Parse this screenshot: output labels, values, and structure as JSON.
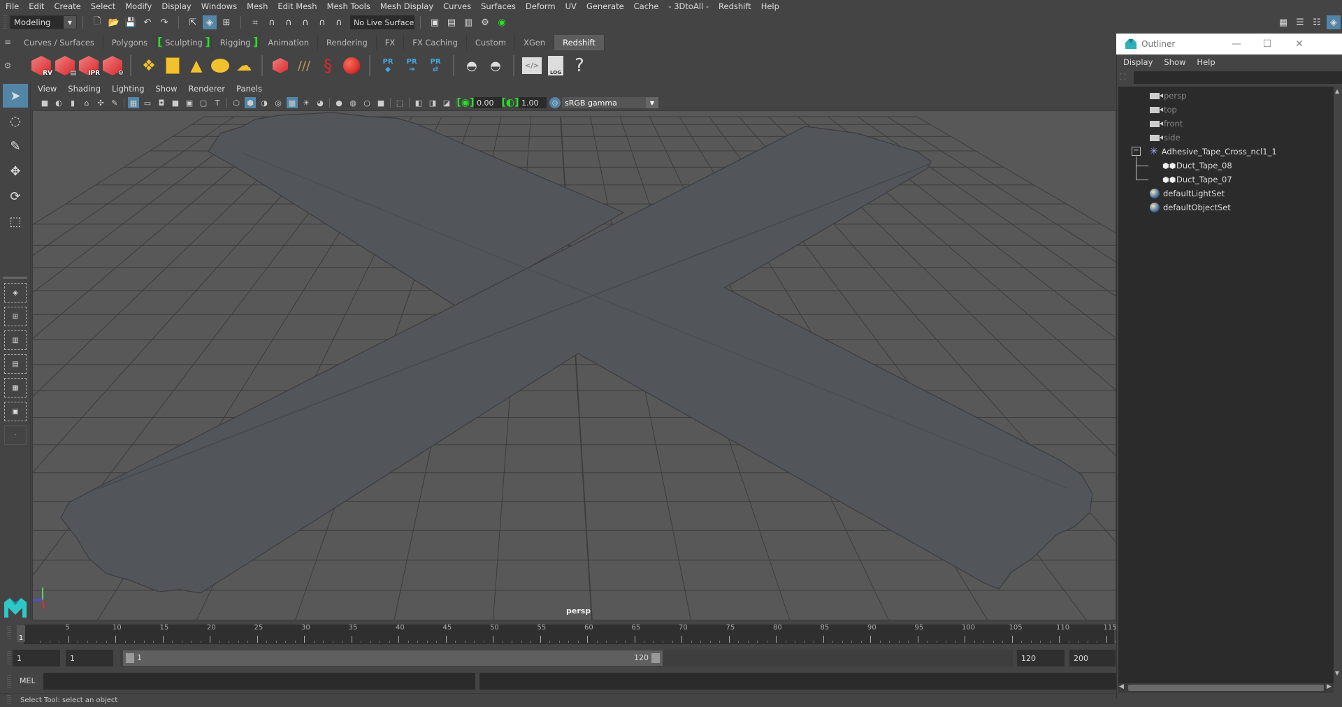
{
  "menubar": [
    "File",
    "Edit",
    "Create",
    "Select",
    "Modify",
    "Display",
    "Windows",
    "Mesh",
    "Edit Mesh",
    "Mesh Tools",
    "Mesh Display",
    "Curves",
    "Surfaces",
    "Deform",
    "UV",
    "Generate",
    "Cache",
    "- 3DtoAll -",
    "Redshift",
    "Help"
  ],
  "statusline": {
    "mode": "Modeling",
    "live_surface": "No Live Surface"
  },
  "shelf": {
    "tabs": [
      {
        "label": "Curves / Surfaces"
      },
      {
        "label": "Polygons"
      },
      {
        "label": "Sculpting"
      },
      {
        "label": "Rigging"
      },
      {
        "label": "Animation"
      },
      {
        "label": "Rendering"
      },
      {
        "label": "FX"
      },
      {
        "label": "FX Caching"
      },
      {
        "label": "Custom"
      },
      {
        "label": "XGen"
      },
      {
        "label": "Redshift",
        "active": true
      }
    ],
    "icons": {
      "rv": "RV",
      "ipr": "IPR",
      "pr": "PR",
      "log": "LOG",
      "help": "?"
    }
  },
  "viewport": {
    "menu": [
      "View",
      "Shading",
      "Lighting",
      "Show",
      "Renderer",
      "Panels"
    ],
    "exposure": "0.00",
    "gamma": "1.00",
    "color_space": "sRGB gamma",
    "camera": "persp",
    "colors": {
      "background": "#585858",
      "grid": "#3c3c3c",
      "tape": "#52555a"
    }
  },
  "timeline": {
    "ticks": [
      "5",
      "10",
      "15",
      "20",
      "25",
      "30",
      "35",
      "40",
      "45",
      "50",
      "55",
      "60",
      "65",
      "70",
      "75",
      "80",
      "85",
      "90",
      "95",
      "100",
      "105",
      "110",
      "115"
    ],
    "current_frame": "1",
    "start_frame": "1",
    "playback_start": "1",
    "range_start": "1",
    "range_end": "120",
    "playback_end": "120",
    "end_frame": "200"
  },
  "command_line": {
    "label": "MEL"
  },
  "status": "Select Tool: select an object",
  "outliner": {
    "title": "Outliner",
    "menu": [
      "Display",
      "Show",
      "Help"
    ],
    "items": [
      {
        "label": "persp",
        "type": "camera"
      },
      {
        "label": "top",
        "type": "camera"
      },
      {
        "label": "front",
        "type": "camera"
      },
      {
        "label": "side",
        "type": "camera"
      },
      {
        "label": "Adhesive_Tape_Cross_ncl1_1",
        "type": "group"
      },
      {
        "label": "Duct_Tape_08",
        "type": "mesh"
      },
      {
        "label": "Duct_Tape_07",
        "type": "mesh"
      },
      {
        "label": "defaultLightSet",
        "type": "set"
      },
      {
        "label": "defaultObjectSet",
        "type": "set"
      }
    ]
  }
}
